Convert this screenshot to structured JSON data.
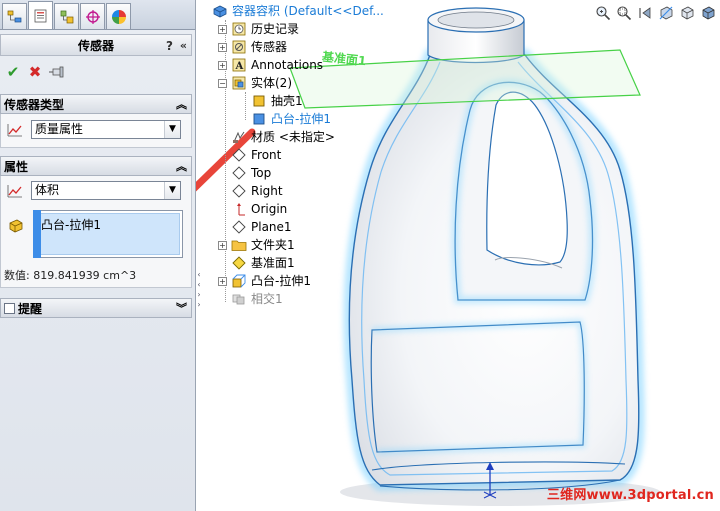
{
  "property_manager": {
    "tabs": [
      "feature-manager",
      "property-manager",
      "configuration-manager",
      "dimxpert-manager",
      "display-manager"
    ],
    "title": "传感器",
    "help_label": "?",
    "collapse_label": "«",
    "ok_icon": "✔",
    "cancel_icon": "✖",
    "pin_icon": "pin",
    "sensor_type": {
      "header": "传感器类型",
      "selected": "质量属性"
    },
    "properties": {
      "header": "属性",
      "property_selected": "体积",
      "list_selected": "凸台-拉伸1",
      "value_text": "数值: 819.841939 cm^3"
    },
    "alert": {
      "header": "提醒"
    }
  },
  "feature_tree": {
    "root": "容器容积  (Default<<Def...",
    "items": [
      {
        "label": "历史记录",
        "icon": "history-icon",
        "expandable": true
      },
      {
        "label": "传感器",
        "icon": "sensor-icon",
        "expandable": true
      },
      {
        "label": "Annotations",
        "icon": "annotations-icon",
        "expandable": true
      },
      {
        "label": "实体(2)",
        "icon": "solid-bodies-icon",
        "expandable": true
      },
      {
        "label": "抽壳1",
        "icon": "shell-icon",
        "expandable": false
      },
      {
        "label": "凸台-拉伸1",
        "icon": "extrude-body-icon",
        "expandable": false
      },
      {
        "label": "材质 <未指定>",
        "icon": "material-icon",
        "expandable": false
      },
      {
        "label": "Front",
        "icon": "plane-icon",
        "expandable": false
      },
      {
        "label": "Top",
        "icon": "plane-icon",
        "expandable": false
      },
      {
        "label": "Right",
        "icon": "plane-icon",
        "expandable": false
      },
      {
        "label": "Origin",
        "icon": "origin-icon",
        "expandable": false
      },
      {
        "label": "Plane1",
        "icon": "plane-icon",
        "expandable": false
      },
      {
        "label": "文件夹1",
        "icon": "folder-icon",
        "expandable": true
      },
      {
        "label": "基准面1",
        "icon": "datum-plane-icon",
        "expandable": false
      },
      {
        "label": "凸台-拉伸1",
        "icon": "extrude-feature-icon",
        "expandable": true
      },
      {
        "label": "相交1",
        "icon": "intersect-icon",
        "expandable": false
      }
    ]
  },
  "viewport": {
    "plane_label": "基准面1",
    "watermark": "三维网www.3dportal.cn"
  },
  "colors": {
    "accent_blue": "#1a7bd6",
    "arrow_red": "#e8453a",
    "plane_green": "#4fd84f",
    "watermark_red": "#e0261e"
  }
}
